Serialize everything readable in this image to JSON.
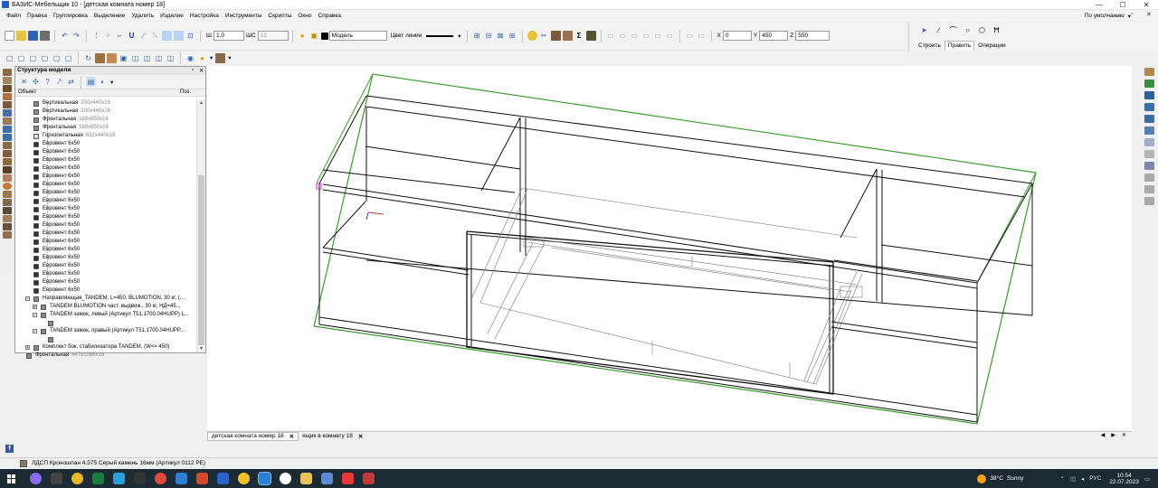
{
  "window": {
    "title": "БАЗИС-Мебельщик 10 - [детская комната номер 18]",
    "minimize": "—",
    "maximize": "☐",
    "close": "✕"
  },
  "menu": {
    "items": [
      "Файл",
      "Правка",
      "Группировка",
      "Выделение",
      "Удалить",
      "Изделие",
      "Настройка",
      "Инструменты",
      "Скрипты",
      "Окно",
      "Справка"
    ],
    "profile": "По умолчанию",
    "profile_arrow": "▾",
    "mdi_min": "_",
    "mdi_restore": "▫",
    "mdi_close": "✕"
  },
  "toolbar": {
    "width_label": "Ш",
    "width_value": "1.0",
    "step_label": "ШС",
    "step_value": "12",
    "line_color_label": "Цвет линии",
    "layer_value": "Модель",
    "x_label": "X",
    "x_value": "0",
    "y_label": "Y",
    "y_value": "450",
    "z_label": "Z",
    "z_value": "550"
  },
  "command_panel": {
    "tabs": [
      "Строить",
      "Править",
      "Операции"
    ],
    "active_tab": "Править"
  },
  "tree": {
    "title": "Структура модели",
    "col_object": "Объект",
    "col_pos": "Поз.",
    "rows": [
      {
        "name": "Вертикальная",
        "dim": "200x440x16",
        "icon": "panel",
        "indent": 1
      },
      {
        "name": "Вертикальная",
        "dim": "200x440x16",
        "icon": "panel",
        "indent": 1
      },
      {
        "name": "Фронтальная",
        "dim": "168x650x16",
        "icon": "panel",
        "indent": 1
      },
      {
        "name": "Фронтальная",
        "dim": "168x650x16",
        "icon": "panel",
        "indent": 1
      },
      {
        "name": "Горизонтальная",
        "dim": "632x440x16",
        "icon": "doc",
        "indent": 1
      },
      {
        "name": "Евровинт 6x50",
        "dim": "",
        "icon": "screw",
        "indent": 1
      },
      {
        "name": "Евровинт 6x50",
        "dim": "",
        "icon": "screw",
        "indent": 1
      },
      {
        "name": "Евровинт 6x50",
        "dim": "",
        "icon": "screw",
        "indent": 1
      },
      {
        "name": "Евровинт 6x50",
        "dim": "",
        "icon": "screw",
        "indent": 1
      },
      {
        "name": "Евровинт 6x50",
        "dim": "",
        "icon": "screw",
        "indent": 1
      },
      {
        "name": "Евровинт 6x50",
        "dim": "",
        "icon": "screw",
        "indent": 1
      },
      {
        "name": "Евровинт 6x50",
        "dim": "",
        "icon": "screw",
        "indent": 1
      },
      {
        "name": "Евровинт 6x50",
        "dim": "",
        "icon": "screw",
        "indent": 1
      },
      {
        "name": "Евровинт 6x50",
        "dim": "",
        "icon": "screw",
        "indent": 1
      },
      {
        "name": "Евровинт 6x50",
        "dim": "",
        "icon": "screw",
        "indent": 1
      },
      {
        "name": "Евровинт 6x50",
        "dim": "",
        "icon": "screw",
        "indent": 1
      },
      {
        "name": "Евровинт 6x50",
        "dim": "",
        "icon": "screw",
        "indent": 1
      },
      {
        "name": "Евровинт 6x50",
        "dim": "",
        "icon": "screw",
        "indent": 1
      },
      {
        "name": "Евровинт 6x50",
        "dim": "",
        "icon": "screw",
        "indent": 1
      },
      {
        "name": "Евровинт 6x50",
        "dim": "",
        "icon": "screw",
        "indent": 1
      },
      {
        "name": "Евровинт 6x50",
        "dim": "",
        "icon": "screw",
        "indent": 1
      },
      {
        "name": "Евровинт 6x50",
        "dim": "",
        "icon": "screw",
        "indent": 1
      },
      {
        "name": "Евровинт 6x50",
        "dim": "",
        "icon": "screw",
        "indent": 1
      },
      {
        "name": "Евровинт 6x50",
        "dim": "",
        "icon": "screw",
        "indent": 1
      },
      {
        "name": "Направляющая_TANDEM, L=450, BLUMOTION, 30 кг. (...",
        "dim": "",
        "icon": "rail",
        "indent": 1,
        "expander": "−"
      },
      {
        "name": "TANDEM BLUMOTION част. выдвиж., 30 кг, НД=45...",
        "dim": "",
        "icon": "rail",
        "indent": 2,
        "expander": "+"
      },
      {
        "name": "TANDEM замок, левый (Артикул T51.1700.04HUPP) L...",
        "dim": "",
        "icon": "rail",
        "indent": 2,
        "expander": "−"
      },
      {
        "name": "",
        "dim": "",
        "icon": "rail",
        "indent": 3
      },
      {
        "name": "TANDEM замок, правый (Артикул T51.1700.04HUPP...",
        "dim": "",
        "icon": "rail",
        "indent": 2,
        "expander": "−"
      },
      {
        "name": "",
        "dim": "",
        "icon": "rail",
        "indent": 3
      },
      {
        "name": "Комплект бок. стабилизатора TANDEM, (W<= 450)",
        "dim": "",
        "icon": "rail",
        "indent": 1,
        "expander": "+"
      },
      {
        "name": "Фронтальная",
        "dim": "447x1086x16",
        "icon": "panel",
        "indent": 0
      }
    ]
  },
  "doc_tabs": [
    {
      "label": "детская комната номер 18",
      "active": true
    },
    {
      "label": "ящик в комнату 18",
      "active": false
    }
  ],
  "tab_nav": [
    "◀",
    "▶",
    "✕"
  ],
  "status": {
    "material": "ЛДСП Кроношпан 4.575 Серый камень 16мм (Артикул 0112 PE)"
  },
  "taskbar": {
    "temperature": "38°C",
    "weather": "Sunny",
    "language": "РУС",
    "time": "10:54",
    "date": "22.07.2023"
  },
  "colors": {
    "selection_green": "#3a9b2c",
    "accent_blue": "#2b5fa8",
    "taskbar_bg": "#1c2a33"
  }
}
